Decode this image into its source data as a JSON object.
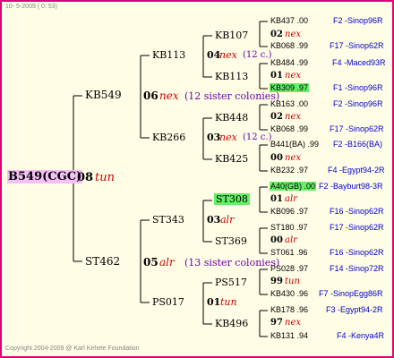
{
  "header": {
    "date": "10- 5-2009 ( 0: 53)"
  },
  "footer": "Copyright 2004-2009 @ Karl Kehele Foundation",
  "root": {
    "name": "B549(CGC)",
    "num": "08",
    "col": "tun"
  },
  "gen1": [
    {
      "name": "KB549",
      "num": "06",
      "col": "nex",
      "note": "(12 sister colonies)"
    },
    {
      "name": "ST462",
      "num": "05",
      "col": "alr",
      "note": "(13 sister colonies)"
    }
  ],
  "gen2": [
    {
      "name": "KB113",
      "num": "04",
      "col": "nex",
      "note": "(12 c.)"
    },
    {
      "name": "KB266",
      "num": "03",
      "col": "nex",
      "note": "(12 c.)"
    },
    {
      "name": "ST343",
      "num": "03",
      "col": "alr"
    },
    {
      "name": "PS017",
      "num": "01",
      "col": "tun"
    }
  ],
  "gen3": [
    {
      "name": "KB107",
      "num": "02",
      "col": "nex"
    },
    {
      "name": "KB113",
      "num": "01",
      "col": "nex"
    },
    {
      "name": "KB448",
      "num": "02",
      "col": "nex"
    },
    {
      "name": "KB425",
      "num": "00",
      "col": "nex"
    },
    {
      "name": "ST308",
      "num": "01",
      "col": "alr"
    },
    {
      "name": "ST369",
      "num": "00",
      "col": "alr"
    },
    {
      "name": "PS517",
      "num": "99",
      "col": "tun"
    },
    {
      "name": "KB496",
      "num": "97",
      "col": "nex"
    }
  ],
  "gen4": [
    {
      "name": "KB437 .00",
      "ref": "F2 -Sinop96R"
    },
    {
      "name": "KB068 .99",
      "ref": "F17 -Sinop62R"
    },
    {
      "name": "KB484 .99",
      "ref": "F4 -Maced93R"
    },
    {
      "name": "KB309 .97",
      "ref": "F1 -Sinop96R"
    },
    {
      "name": "KB163 .00",
      "ref": "F2 -Sinop96R"
    },
    {
      "name": "KB068 .99",
      "ref": "F17 -Sinop62R"
    },
    {
      "name": "B441(BA) .99",
      "ref": "F2 -B166(BA)"
    },
    {
      "name": "KB232 .97",
      "ref": "F4 -Egypt94-2R"
    },
    {
      "name": "A40(GB) .00",
      "ref": "F2 -Bayburt98-3R"
    },
    {
      "name": "KB096 .97",
      "ref": "F16 -Sinop62R"
    },
    {
      "name": "ST180 .97",
      "ref": "F17 -Sinop62R"
    },
    {
      "name": "ST061 .96",
      "ref": "F16 -Sinop62R"
    },
    {
      "name": "PS028 .97",
      "ref": "F14 -Sinop72R"
    },
    {
      "name": "KB430 .96",
      "ref": "F7 -SinopEgg86R"
    },
    {
      "name": "KB178 .96",
      "ref": "F3 -Egypt94-2R"
    },
    {
      "name": "KB131 .94",
      "ref": "F4 -Kenya4R"
    }
  ]
}
